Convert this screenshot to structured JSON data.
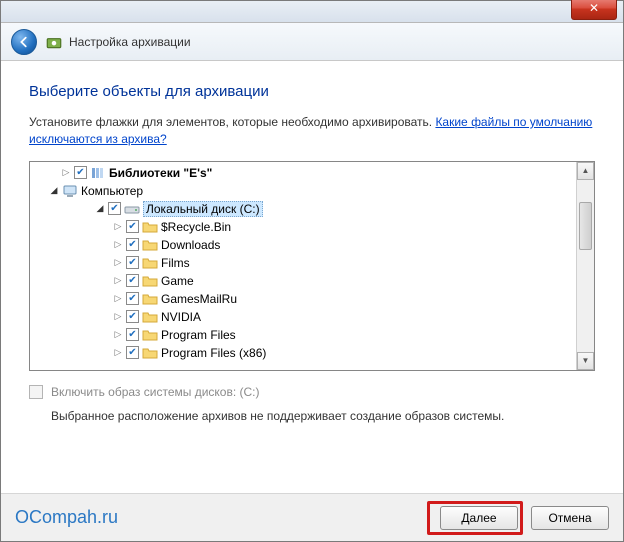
{
  "header": {
    "title": "Настройка архивации"
  },
  "page": {
    "title": "Выберите объекты для архивации",
    "instruction": "Установите флажки для элементов, которые необходимо архивировать. ",
    "link": "Какие файлы по умолчанию исключаются из архива?"
  },
  "tree": {
    "libraries": "Библиотеки \"E's\"",
    "computer": "Компьютер",
    "drive": "Локальный диск (C:)",
    "folders": [
      "$Recycle.Bin",
      "Downloads",
      "Films",
      "Game",
      "GamesMailRu",
      "NVIDIA",
      "Program Files",
      "Program Files (x86)"
    ]
  },
  "option": {
    "label": "Включить образ системы дисков: (C:)"
  },
  "warning": "Выбранное расположение архивов не поддерживает создание образов системы.",
  "footer": {
    "watermark": "OCompah.ru",
    "next": "Далее",
    "cancel": "Отмена"
  }
}
